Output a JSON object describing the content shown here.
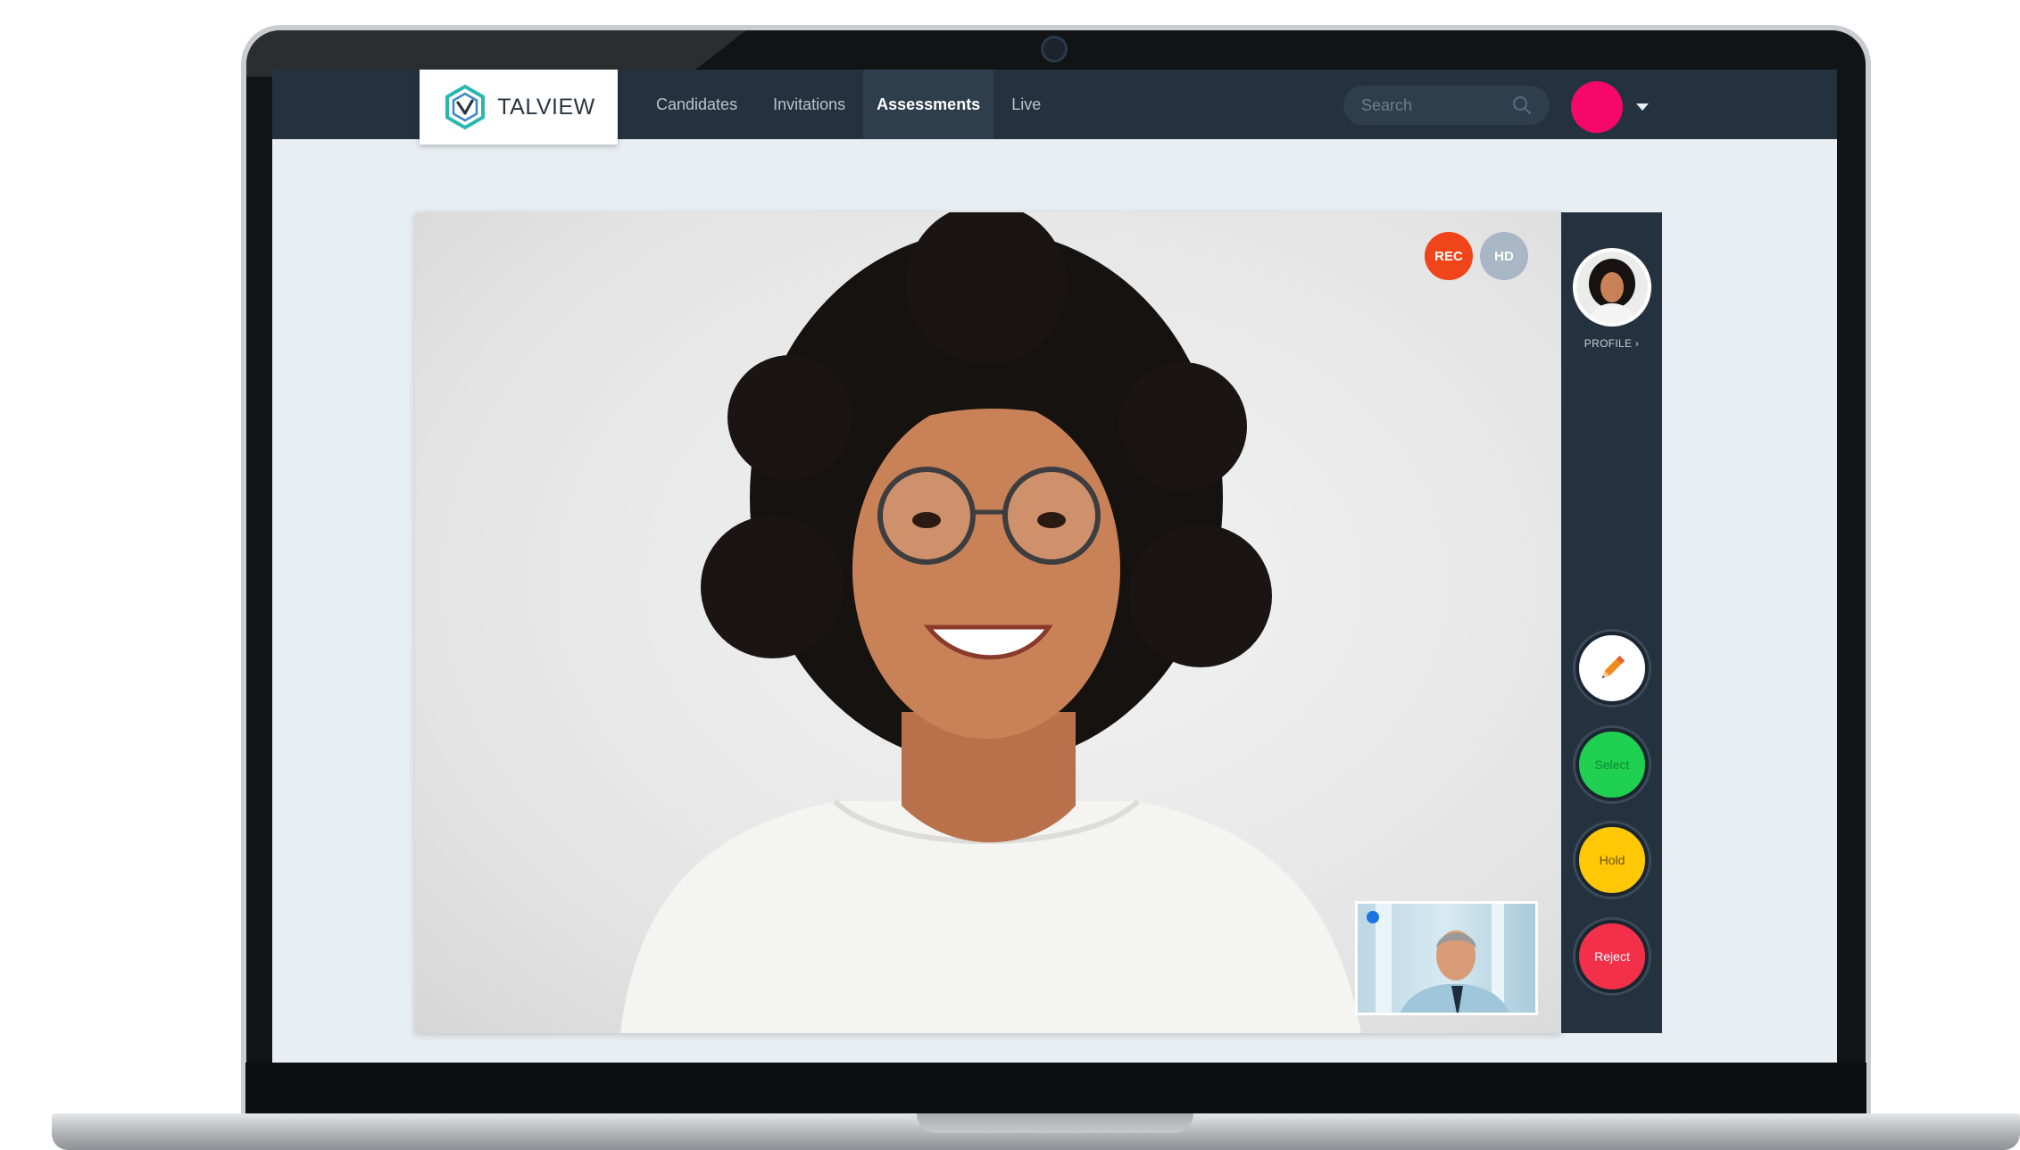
{
  "app": {
    "logo_text": "TALVIEW"
  },
  "nav": {
    "links": [
      "Candidates",
      "Invitations",
      "Assessments",
      "Live"
    ],
    "active": "Assessments"
  },
  "search": {
    "placeholder": "Search"
  },
  "video": {
    "rec_label": "REC",
    "hd_label": "HD"
  },
  "side_panel": {
    "profile_label": "PROFILE",
    "actions": {
      "select": "Select",
      "hold": "Hold",
      "reject": "Reject"
    }
  },
  "colors": {
    "navbar": "#24323f",
    "avatar": "#f5076c",
    "rec": "#f0441b",
    "hd": "#a8b6c6",
    "select": "#1fd051",
    "hold": "#ffc807",
    "reject": "#f3304a"
  },
  "icons": [
    "hexagon-logo-icon",
    "search-icon",
    "chevron-down-icon",
    "chevron-right-icon",
    "pencil-icon",
    "camera-icon"
  ]
}
